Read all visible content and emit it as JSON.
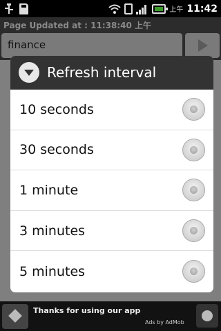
{
  "status_bar": {
    "icons": [
      "usb-icon",
      "sd-card-icon",
      "wifi-icon",
      "phone-icon",
      "signal-icon",
      "battery-icon"
    ],
    "ampm": "上午",
    "time": "11:42"
  },
  "app": {
    "page_updated": "Page Updated at : 11:38:40 上午",
    "search_value": "finance"
  },
  "dialog": {
    "title": "Refresh interval",
    "options": [
      {
        "label": "10 seconds",
        "selected": false
      },
      {
        "label": "30 seconds",
        "selected": false
      },
      {
        "label": "1 minute",
        "selected": false
      },
      {
        "label": "3 minutes",
        "selected": false
      },
      {
        "label": "5 minutes",
        "selected": false
      }
    ]
  },
  "ad": {
    "text": "Thanks for using our app",
    "attribution": "Ads by AdMob"
  },
  "colors": {
    "dialog_header": "#333333",
    "dialog_body": "#ffffff",
    "dimmed_background": "#7f7f7f"
  }
}
